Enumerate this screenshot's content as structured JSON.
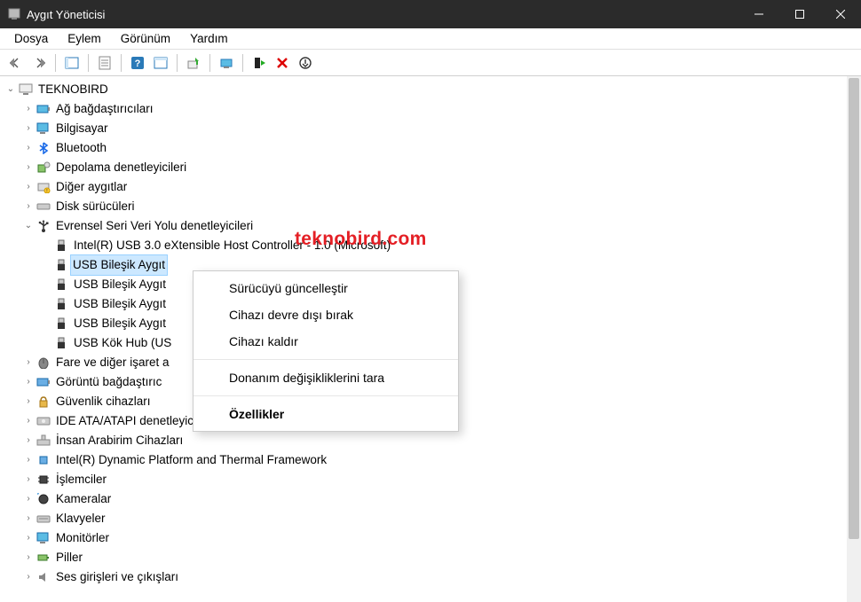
{
  "window": {
    "title": "Aygıt Yöneticisi"
  },
  "menubar": {
    "file": "Dosya",
    "action": "Eylem",
    "view": "Görünüm",
    "help": "Yardım"
  },
  "watermark": "teknobird.com",
  "tree": {
    "root": "TEKNOBIRD",
    "items": [
      {
        "label": "Ağ bağdaştırıcıları"
      },
      {
        "label": "Bilgisayar"
      },
      {
        "label": "Bluetooth"
      },
      {
        "label": "Depolama denetleyicileri"
      },
      {
        "label": "Diğer aygıtlar"
      },
      {
        "label": "Disk sürücüleri"
      },
      {
        "label": "Evrensel Seri Veri Yolu denetleyicileri",
        "expanded": true,
        "children": [
          {
            "label": "Intel(R) USB 3.0 eXtensible Host Controller - 1.0 (Microsoft)"
          },
          {
            "label": "USB Bileşik Aygıt",
            "selected": true
          },
          {
            "label": "USB Bileşik Aygıt"
          },
          {
            "label": "USB Bileşik Aygıt"
          },
          {
            "label": "USB Bileşik Aygıt"
          },
          {
            "label": "USB Kök Hub (US"
          }
        ]
      },
      {
        "label": "Fare ve diğer işaret a"
      },
      {
        "label": "Görüntü bağdaştırıc"
      },
      {
        "label": "Güvenlik cihazları"
      },
      {
        "label": "IDE ATA/ATAPI denetleyiciler"
      },
      {
        "label": "İnsan Arabirim Cihazları"
      },
      {
        "label": "Intel(R) Dynamic Platform and Thermal Framework"
      },
      {
        "label": "İşlemciler"
      },
      {
        "label": "Kameralar"
      },
      {
        "label": "Klavyeler"
      },
      {
        "label": "Monitörler"
      },
      {
        "label": "Piller"
      },
      {
        "label": "Ses girişleri ve çıkışları"
      }
    ]
  },
  "context_menu": {
    "update_driver": "Sürücüyü güncelleştir",
    "disable_device": "Cihazı devre dışı bırak",
    "uninstall_device": "Cihazı kaldır",
    "scan_hardware": "Donanım değişikliklerini tara",
    "properties": "Özellikler"
  }
}
